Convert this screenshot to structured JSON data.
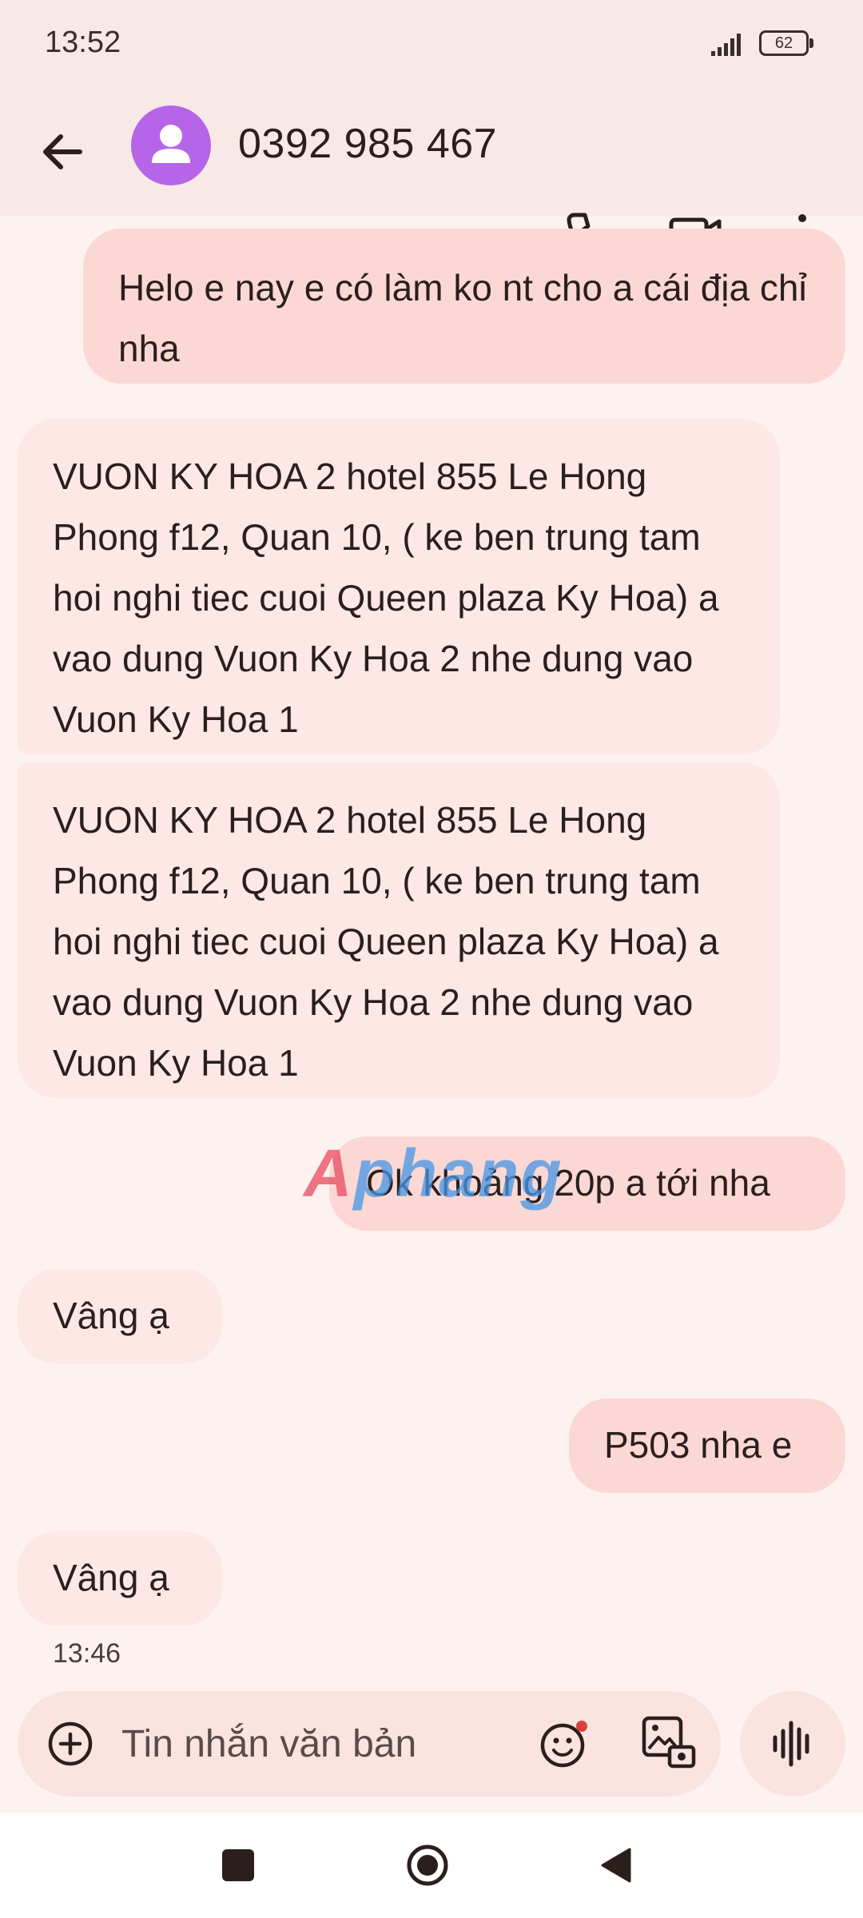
{
  "status_bar": {
    "time": "13:52",
    "battery": "62"
  },
  "header": {
    "contact_name": "0392 985 467"
  },
  "messages": [
    {
      "direction": "outgoing",
      "text": "Helo e nay e có làm ko nt cho a cái địa chỉ nha"
    },
    {
      "direction": "incoming",
      "text": "VUON KY HOA 2 hotel 855 Le Hong Phong f12, Quan 10, ( ke ben trung tam hoi nghi tiec cuoi Queen plaza Ky Hoa) a vao dung Vuon Ky Hoa 2 nhe dung vao Vuon Ky Hoa 1"
    },
    {
      "direction": "incoming",
      "text": "VUON KY HOA 2 hotel 855 Le Hong Phong f12, Quan 10, ( ke ben trung tam hoi nghi tiec cuoi Queen plaza Ky Hoa) a vao dung Vuon Ky Hoa 2 nhe dung vao Vuon Ky Hoa 1"
    },
    {
      "direction": "outgoing",
      "text": "Ok khoảng 20p a tới nha"
    },
    {
      "direction": "incoming",
      "text": "Vâng ạ"
    },
    {
      "direction": "outgoing",
      "text": "P503 nha e"
    },
    {
      "direction": "incoming",
      "text": "Vâng ạ"
    }
  ],
  "last_message_time": "13:46",
  "compose": {
    "placeholder": "Tin nhắn văn bản"
  },
  "watermark": {
    "first": "A",
    "rest": "phang"
  },
  "icons": {
    "back": "arrow-left-icon",
    "avatar": "person-icon",
    "call": "phone-icon",
    "video": "video-camera-icon",
    "more": "more-vert-icon",
    "add": "add-circle-icon",
    "emoji": "emoji-icon",
    "gallery": "gallery-icon",
    "voice": "voice-waveform-icon"
  },
  "colors": {
    "avatar": "#b765e8",
    "outgoing_bubble": "#fcd8d4",
    "incoming_bubble": "#fde8e5",
    "background": "#fdf2f0"
  }
}
